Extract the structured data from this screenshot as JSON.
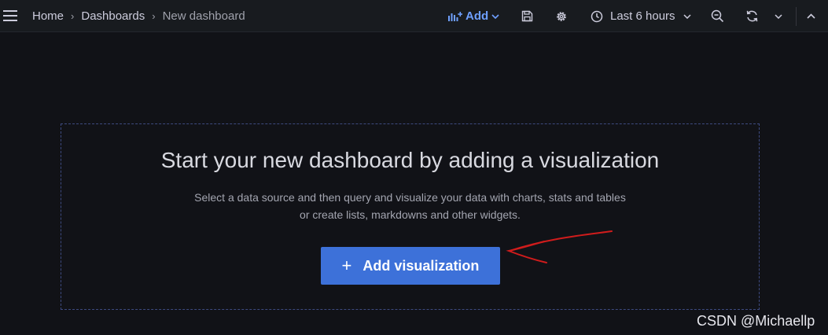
{
  "topbar": {
    "breadcrumb": {
      "home": "Home",
      "dashboards": "Dashboards",
      "current": "New dashboard"
    },
    "add_label": "Add",
    "time_range": "Last 6 hours"
  },
  "main": {
    "title": "Start your new dashboard by adding a visualization",
    "description_line1": "Select a data source and then query and visualize your data with charts, stats and tables",
    "description_line2": "or create lists, markdowns and other widgets.",
    "add_visualization_label": "Add visualization"
  },
  "watermark": "CSDN @Michaellp",
  "icons": {
    "menu": "hamburger-menu-icon",
    "add": "add-panel-icon",
    "save": "save-icon",
    "settings": "gear-icon",
    "time": "clock-icon",
    "zoom": "zoom-out-icon",
    "refresh": "refresh-icon",
    "collapse": "chevron-up-icon",
    "annotation": "red-arrow-annotation"
  },
  "colors": {
    "background": "#111217",
    "topbar": "#181b1f",
    "accent": "#6e9fff",
    "primary_button": "#3d71d9",
    "annotation": "#d01c1c"
  }
}
